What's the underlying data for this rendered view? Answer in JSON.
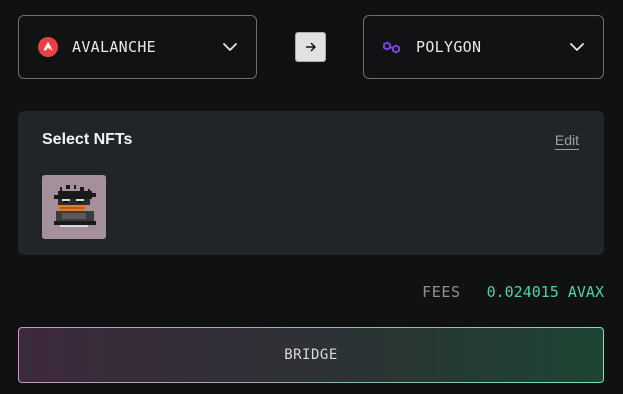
{
  "bridge": {
    "from_chain": {
      "label": "AVALANCHE",
      "icon": "avalanche-logo-icon",
      "color": "#e84142"
    },
    "to_chain": {
      "label": "POLYGON",
      "icon": "polygon-logo-icon",
      "color": "#8247e5"
    },
    "swap_icon": "arrow-right-icon"
  },
  "nfts": {
    "title": "Select NFTs",
    "edit_label": "Edit",
    "items": [
      {
        "icon": "pixel-art-nft-thumbnail",
        "background": "#a3909c"
      }
    ]
  },
  "fees": {
    "label": "FEES",
    "value": "0.024015 AVAX",
    "value_color": "#4fd3a2"
  },
  "action": {
    "label": "BRIDGE"
  }
}
